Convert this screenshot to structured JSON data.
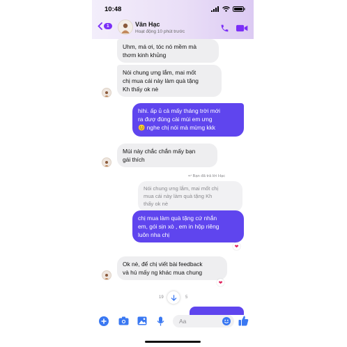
{
  "status_bar": {
    "time": "10:48"
  },
  "header": {
    "back_badge": "1",
    "contact_name": "Vân Hạc",
    "contact_status": "Hoạt động 10 phút trước",
    "icons": [
      "back-chevron-icon",
      "phone-icon",
      "video-call-icon"
    ],
    "accent_color": "#7b2ff7"
  },
  "messages": [
    {
      "from": "them",
      "text_lines": [
        "Uhm, má ơi, tóc nó mềm mà",
        "thơm kinh khủng"
      ]
    },
    {
      "from": "them",
      "text_lines": [
        "Nói chung ưng lắm, mai mốt",
        "chị mua cái này làm quà tặng",
        "Kh thấy ok nè"
      ]
    },
    {
      "from": "me",
      "text_lines": [
        "hihi. ấp ủ cả mấy tháng trời mới",
        "ra đượ đúng cài mùi em ưng",
        "😊 nghe chị nói mà mừng kkk"
      ]
    },
    {
      "from": "them",
      "text_lines": [
        "Mùi này chắc chắn mấy bạn",
        "gái thích"
      ]
    },
    {
      "from": "me",
      "reply_note": "Bạn đã trả lời Hạc",
      "quote_lines": [
        "Nói chung ưng lắm, mai mốt chị",
        "mua cái này làm quà tặng Kh",
        "thấy ok nè"
      ],
      "text_lines": [
        "chị mua làm quà tặng cứ nhắn",
        "em, gói sịn xò , em in hộp riêng",
        "luôn nha chị"
      ],
      "reaction": "❤"
    },
    {
      "from": "them",
      "text_lines": [
        "Ok nè, để chị viết bài feedback",
        "và hú mấy ng khác mua chung"
      ],
      "reaction": "❤"
    }
  ],
  "timestamp_partial": [
    "19",
    "5"
  ],
  "composer": {
    "placeholder": "Aa",
    "icons": [
      "plus-icon",
      "camera-icon",
      "image-icon",
      "microphone-icon",
      "emoji-icon",
      "thumbs-up-icon"
    ]
  },
  "colors": {
    "outgoing_bubble": "#5f45ee",
    "incoming_bubble": "#eeeef0",
    "reaction_heart": "#e0245e"
  }
}
